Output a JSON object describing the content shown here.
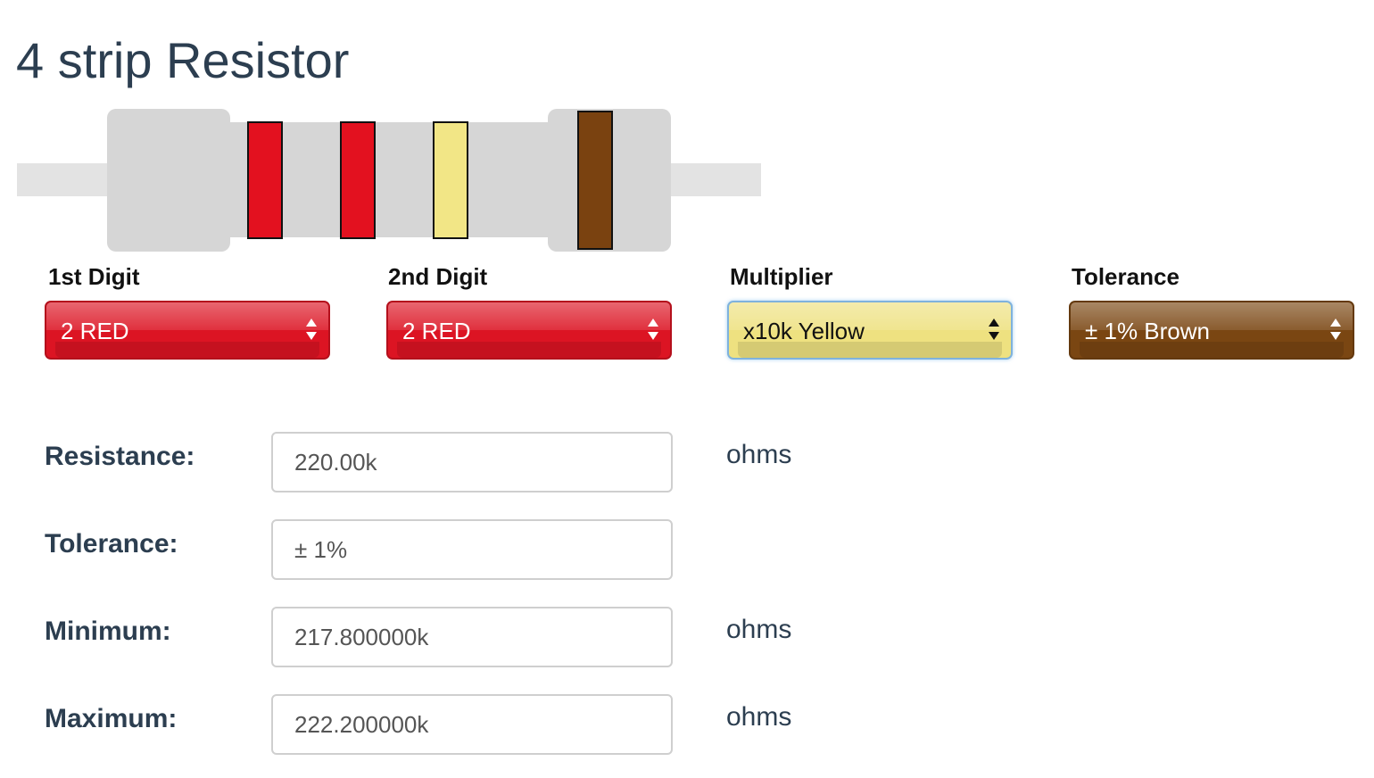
{
  "page": {
    "title": "4 strip Resistor"
  },
  "resistor": {
    "bands": [
      {
        "color": "#e3111f"
      },
      {
        "color": "#e3111f"
      },
      {
        "color": "#f2e686"
      },
      {
        "color": "#7a4210"
      }
    ]
  },
  "selectors": [
    {
      "label": "1st Digit",
      "value": "2 RED",
      "color": "#dc1423"
    },
    {
      "label": "2nd Digit",
      "value": "2 RED",
      "color": "#dc1423"
    },
    {
      "label": "Multiplier",
      "value": "x10k Yellow",
      "color": "#eee180"
    },
    {
      "label": "Tolerance",
      "value": "± 1% Brown",
      "color": "#7a4612"
    }
  ],
  "results": {
    "resistance": {
      "label": "Resistance:",
      "value": "220.00k",
      "unit": "ohms"
    },
    "tolerance": {
      "label": "Tolerance:",
      "value": "± 1%",
      "unit": ""
    },
    "minimum": {
      "label": "Minimum:",
      "value": "217.800000k",
      "unit": "ohms"
    },
    "maximum": {
      "label": "Maximum:",
      "value": "222.200000k",
      "unit": "ohms"
    }
  }
}
